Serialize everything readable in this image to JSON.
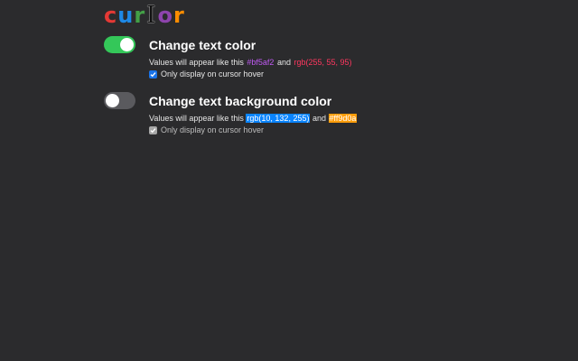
{
  "logo": {
    "letters": [
      {
        "char": "c",
        "color": "#e53935"
      },
      {
        "char": "u",
        "color": "#1e88e5"
      },
      {
        "char": "r",
        "color": "#43a047"
      },
      {
        "char": "I",
        "color": "#111111"
      },
      {
        "char": "o",
        "color": "#8e44ad"
      },
      {
        "char": "r",
        "color": "#fb8c00"
      }
    ]
  },
  "settings": [
    {
      "enabled": true,
      "title": "Change text color",
      "desc_prefix": "Values will appear like this",
      "sample1": {
        "text": "#bf5af2",
        "color": "#bf5af2",
        "background": "transparent"
      },
      "desc_and": "and",
      "sample2": {
        "text": "rgb(255, 55, 95)",
        "color": "#ff375f",
        "background": "transparent"
      },
      "checkbox": {
        "label": "Only display on cursor hover",
        "checked": true,
        "disabled": false
      }
    },
    {
      "enabled": false,
      "title": "Change text background color",
      "desc_prefix": "Values will appear like this",
      "sample1": {
        "text": "rgb(10, 132, 255)",
        "color": "#ffffff",
        "background": "#0a84ff"
      },
      "desc_and": "and",
      "sample2": {
        "text": "#ff9d0a",
        "color": "#ffffff",
        "background": "#ff9d0a"
      },
      "checkbox": {
        "label": "Only display on cursor hover",
        "checked": true,
        "disabled": true
      }
    }
  ],
  "colors": {
    "background": "#2b2b2d",
    "toggle_on": "#34c759",
    "toggle_off": "#5a5a5e",
    "checkbox_checked": "#1a73e8",
    "checkbox_disabled": "#a7a7a7"
  }
}
